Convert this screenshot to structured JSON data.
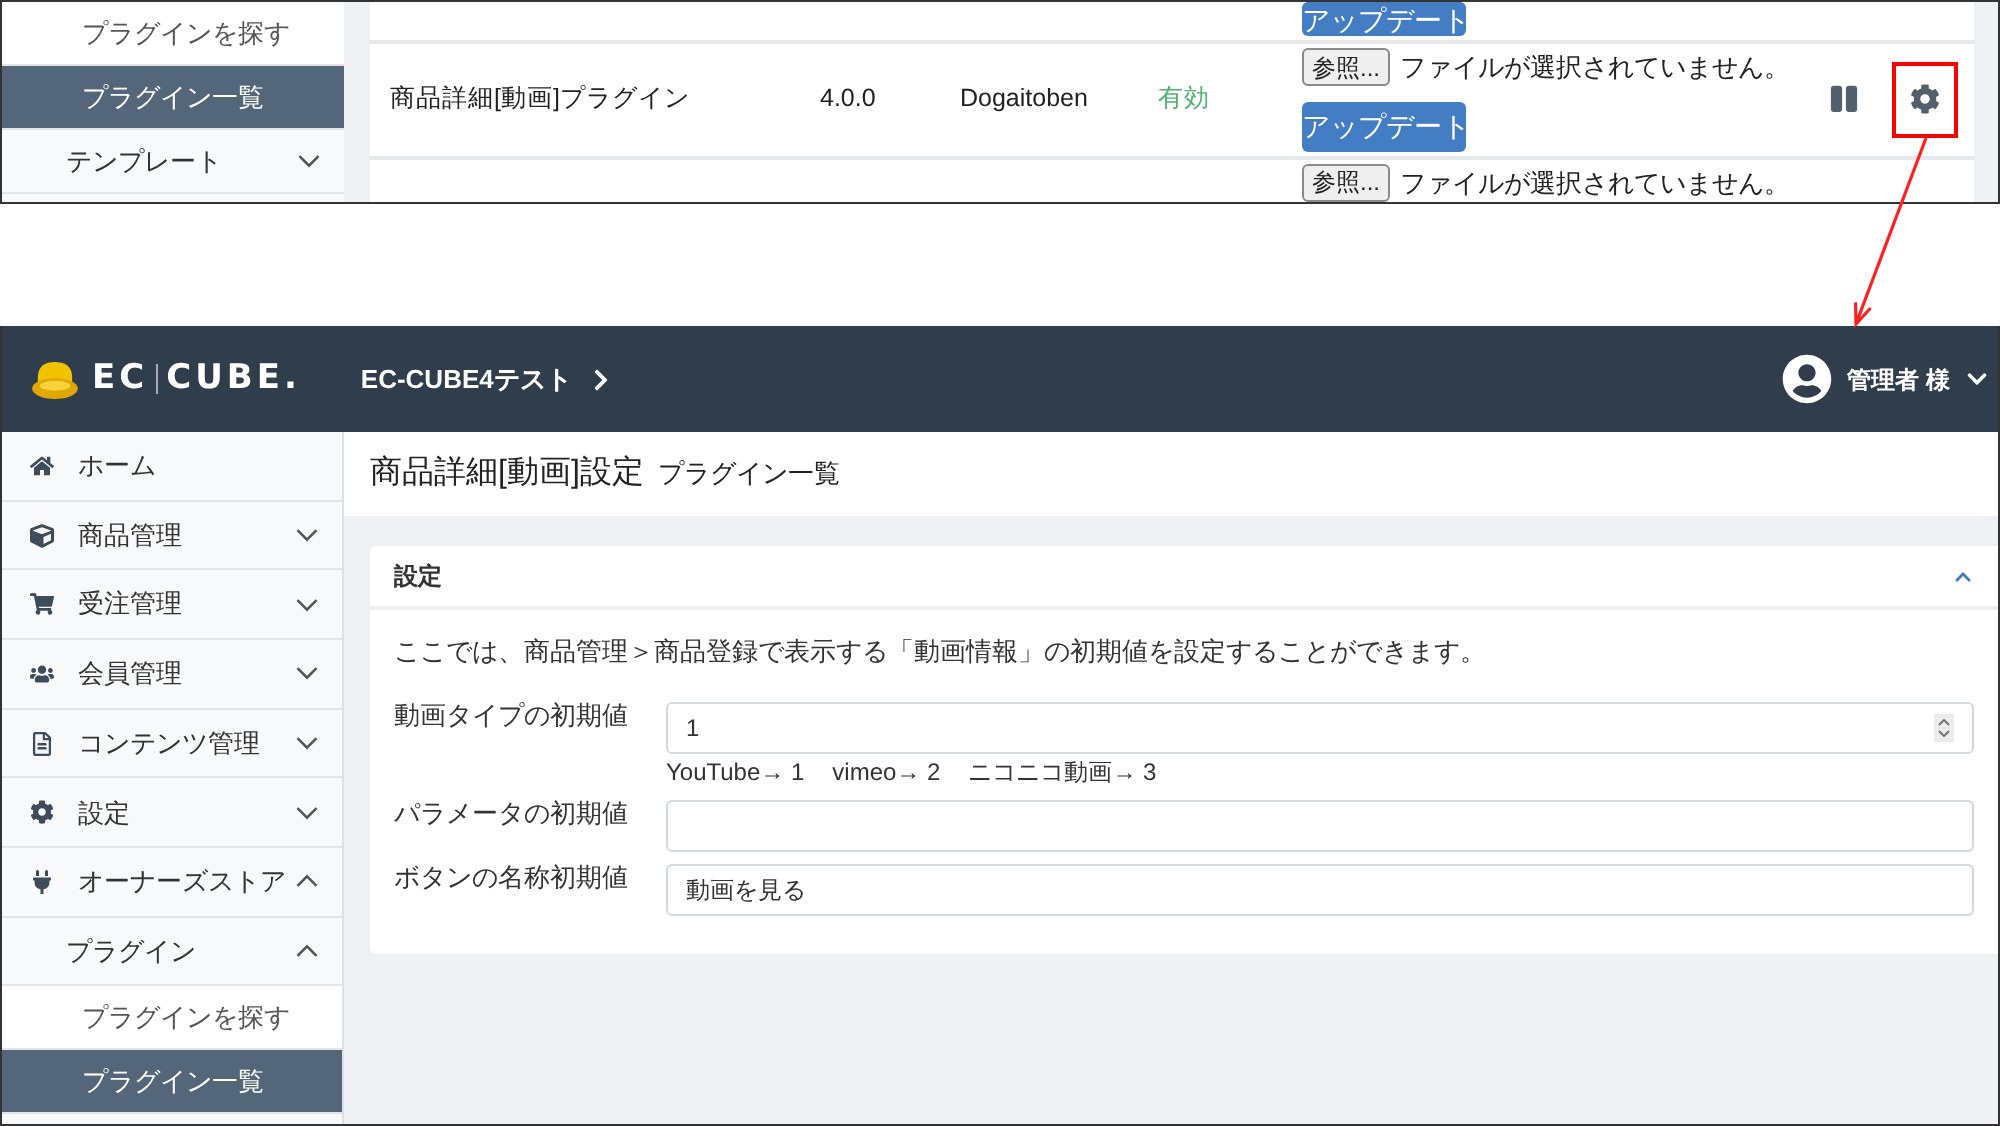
{
  "top_screenshot": {
    "sidebar": [
      {
        "kind": "link",
        "label": "プラグインを探す",
        "selected": false
      },
      {
        "kind": "link",
        "label": "プラグイン一覧",
        "selected": true
      },
      {
        "kind": "group",
        "label": "テンプレート",
        "selected": false,
        "expanded": false
      }
    ],
    "plugins": [
      {
        "kind": "tail",
        "update_button": "アップデート"
      },
      {
        "kind": "full",
        "name": "商品詳細[動画]プラグイン",
        "version": "4.0.0",
        "author": "Dogaitoben",
        "status": "有効",
        "enabled": true,
        "file_button": "参照...",
        "file_status": "ファイルが選択されていません。",
        "update_button": "アップデート",
        "settings_highlighted": true
      },
      {
        "kind": "head",
        "file_button": "参照...",
        "file_status": "ファイルが選択されていません。"
      }
    ]
  },
  "admin": {
    "header": {
      "logo": [
        "EC",
        "CUBE."
      ],
      "shop_name": "EC-CUBE4テスト",
      "user_name": "管理者 様"
    },
    "sidebar": [
      {
        "kind": "link",
        "label": "ホーム",
        "selected": false
      },
      {
        "kind": "group",
        "label": "商品管理",
        "selected": false,
        "expanded": false
      },
      {
        "kind": "group",
        "label": "受注管理",
        "selected": false,
        "expanded": false
      },
      {
        "kind": "group",
        "label": "会員管理",
        "selected": false,
        "expanded": false
      },
      {
        "kind": "group",
        "label": "コンテンツ管理",
        "selected": false,
        "expanded": false
      },
      {
        "kind": "group",
        "label": "設定",
        "selected": false,
        "expanded": false
      },
      {
        "kind": "group",
        "label": "オーナーズストア",
        "selected": false,
        "expanded": true,
        "children": [
          {
            "kind": "group",
            "label": "プラグイン",
            "selected": false,
            "expanded": true,
            "children": [
              {
                "kind": "link",
                "label": "プラグインを探す",
                "selected": false
              },
              {
                "kind": "link",
                "label": "プラグイン一覧",
                "selected": true
              }
            ]
          }
        ]
      }
    ],
    "page_title": "商品詳細[動画]設定",
    "page_subtitle": "プラグイン一覧",
    "card": {
      "title": "設定",
      "expanded": true,
      "description": "ここでは、商品管理＞商品登録で表示する「動画情報」の初期値を設定することができます。",
      "fields": [
        {
          "kind": "number",
          "label": "動画タイプの初期値",
          "value": "1",
          "hints": [
            "YouTube→ 1",
            "vimeo→ 2",
            "ニコニコ動画→ 3"
          ]
        },
        {
          "kind": "text",
          "label": "パラメータの初期値"
        },
        {
          "kind": "text",
          "label": "ボタンの名称初期値",
          "value": "動画を見る"
        }
      ]
    }
  }
}
